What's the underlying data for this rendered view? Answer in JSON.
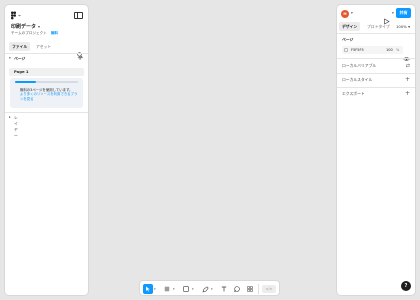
{
  "app": {
    "file_title": "印刷データ",
    "team_name": "チームのプロジェクト",
    "plan_badge": "無料"
  },
  "left_tabs": [
    "ファイル",
    "アセット"
  ],
  "pages_section": {
    "label": "ページ",
    "items": [
      "Page 1"
    ]
  },
  "notice": {
    "message": "無料の3ページを使用しています。",
    "link": "より多くのリソースを利用できるプランを見る",
    "progress": 0.33
  },
  "layers_label": "レイヤー",
  "user": {
    "avatar_initial": "M",
    "avatar_color": "#e4572e"
  },
  "share_label": "共有",
  "right_tabs": [
    "デザイン",
    "プロトタイプ"
  ],
  "zoom_level": "100%",
  "page_props": {
    "label": "ページ",
    "color_hex": "F5F5F5",
    "opacity": "100",
    "opacity_unit": "%"
  },
  "right_sections": [
    "ローカルバリアブル",
    "ローカルスタイル",
    "エクスポート"
  ],
  "help_label": "?",
  "dev_mode_label": "</>",
  "colors": {
    "accent": "#0d99ff",
    "canvas": "#e6e6e6"
  }
}
